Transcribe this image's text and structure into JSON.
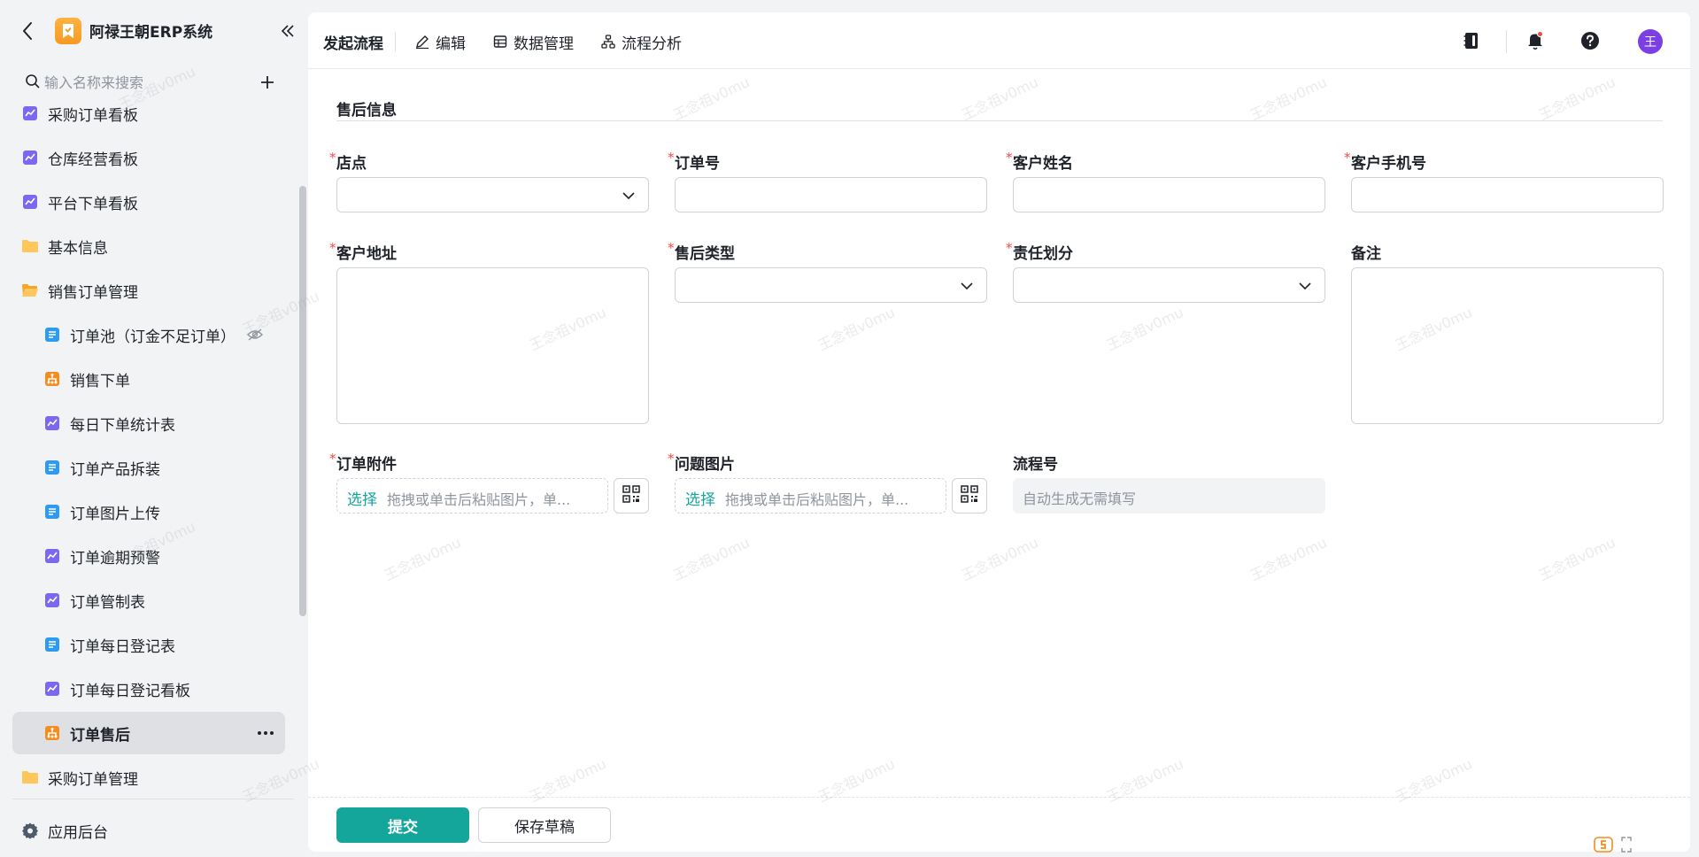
{
  "app": {
    "title": "阿禄王朝ERP系统"
  },
  "search": {
    "placeholder": "输入名称来搜索"
  },
  "nav": {
    "items": [
      {
        "label": "采购订单看板",
        "icon": "chart-icon",
        "level": 0
      },
      {
        "label": "仓库经营看板",
        "icon": "chart-icon",
        "level": 0
      },
      {
        "label": "平台下单看板",
        "icon": "chart-icon",
        "level": 0
      },
      {
        "label": "基本信息",
        "icon": "folder-icon",
        "level": 0
      },
      {
        "label": "销售订单管理",
        "icon": "folder-open-icon",
        "level": 0
      },
      {
        "label": "订单池（订金不足订单）",
        "icon": "form-icon",
        "level": 1,
        "hidden": true
      },
      {
        "label": "销售下单",
        "icon": "flow-icon",
        "level": 1
      },
      {
        "label": "每日下单统计表",
        "icon": "chart-icon",
        "level": 1
      },
      {
        "label": "订单产品拆装",
        "icon": "form-icon",
        "level": 1
      },
      {
        "label": "订单图片上传",
        "icon": "form-icon",
        "level": 1
      },
      {
        "label": "订单逾期预警",
        "icon": "chart-icon",
        "level": 1
      },
      {
        "label": "订单管制表",
        "icon": "chart-icon",
        "level": 1
      },
      {
        "label": "订单每日登记表",
        "icon": "form-icon",
        "level": 1
      },
      {
        "label": "订单每日登记看板",
        "icon": "chart-icon",
        "level": 1
      },
      {
        "label": "订单售后",
        "icon": "flow-icon",
        "level": 1,
        "active": true
      },
      {
        "label": "采购订单管理",
        "icon": "folder-icon",
        "level": 0
      }
    ],
    "footer_label": "应用后台"
  },
  "topbar": {
    "tabs": [
      {
        "label": "发起流程"
      },
      {
        "label": "编辑"
      },
      {
        "label": "数据管理"
      },
      {
        "label": "流程分析"
      }
    ],
    "avatar": "王"
  },
  "form": {
    "section_title": "售后信息",
    "fields": {
      "store": {
        "label": "店点",
        "required": true,
        "type": "select",
        "value": ""
      },
      "order_no": {
        "label": "订单号",
        "required": true,
        "type": "text",
        "value": ""
      },
      "customer_name": {
        "label": "客户姓名",
        "required": true,
        "type": "text",
        "value": ""
      },
      "customer_phone": {
        "label": "客户手机号",
        "required": true,
        "type": "text",
        "value": ""
      },
      "customer_address": {
        "label": "客户地址",
        "required": true,
        "type": "textarea",
        "value": ""
      },
      "aftersale_type": {
        "label": "售后类型",
        "required": true,
        "type": "select",
        "value": ""
      },
      "responsibility": {
        "label": "责任划分",
        "required": true,
        "type": "select",
        "value": ""
      },
      "remark": {
        "label": "备注",
        "required": false,
        "type": "textarea",
        "value": ""
      },
      "order_attachment": {
        "label": "订单附件",
        "required": true,
        "type": "upload",
        "pick": "选择",
        "hint": "拖拽或单击后粘贴图片，单..."
      },
      "problem_images": {
        "label": "问题图片",
        "required": true,
        "type": "upload",
        "pick": "选择",
        "hint": "拖拽或单击后粘贴图片，单..."
      },
      "flow_no": {
        "label": "流程号",
        "required": false,
        "type": "readonly",
        "placeholder": "自动生成无需填写"
      }
    },
    "required_mark": "*"
  },
  "actions": {
    "submit": "提交",
    "save_draft": "保存草稿"
  },
  "watermark": "王念祖v0mu",
  "colors": {
    "accent": "#14a59b",
    "required": "#f54a45",
    "avatar": "#7b3fe4",
    "logo": "#f59a23"
  }
}
